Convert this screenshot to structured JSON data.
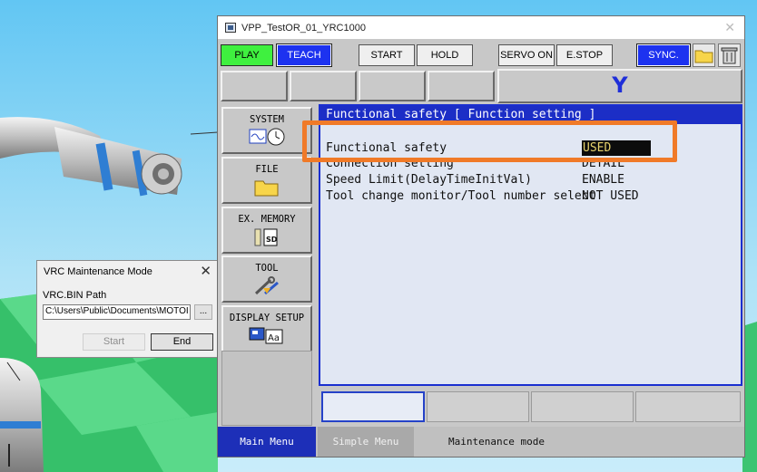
{
  "dialog": {
    "title": "VRC Maintenance Mode",
    "path_label": "VRC.BIN Path",
    "path_value": "C:\\Users\\Public\\Documents\\MOTOI",
    "browse_label": "...",
    "start_label": "Start",
    "end_label": "End"
  },
  "pendant": {
    "window_title": "VPP_TestOR_01_YRC1000",
    "toolbar": {
      "play": "PLAY",
      "teach": "TEACH",
      "start": "START",
      "hold": "HOLD",
      "servo_on": "SERVO ON",
      "estop": "E.STOP",
      "sync": "SYNC."
    },
    "axis_label": "Y",
    "menu": {
      "system": "SYSTEM",
      "file": "FILE",
      "ex_memory": "EX. MEMORY",
      "tool": "TOOL",
      "display_setup": "DISPLAY SETUP"
    },
    "content": {
      "header": "Functional safety [ Function setting ]",
      "rows": [
        {
          "label": "Functional safety",
          "value": "USED"
        },
        {
          "label": "Connection setting",
          "value": "DETAIL"
        },
        {
          "label": "Speed Limit(DelayTimeInitVal)",
          "value": "ENABLE"
        },
        {
          "label": "Tool change monitor/Tool number select",
          "value": "NOT USED"
        }
      ]
    },
    "status": {
      "main_menu": "Main Menu",
      "simple_menu": "Simple Menu",
      "mode": "Maintenance mode"
    }
  },
  "colors": {
    "play": "#3ff03f",
    "teach": "#1d32f0",
    "header": "#1c2ec6",
    "highlight": "#f07a28",
    "selected_value_text": "#e6d26c"
  }
}
